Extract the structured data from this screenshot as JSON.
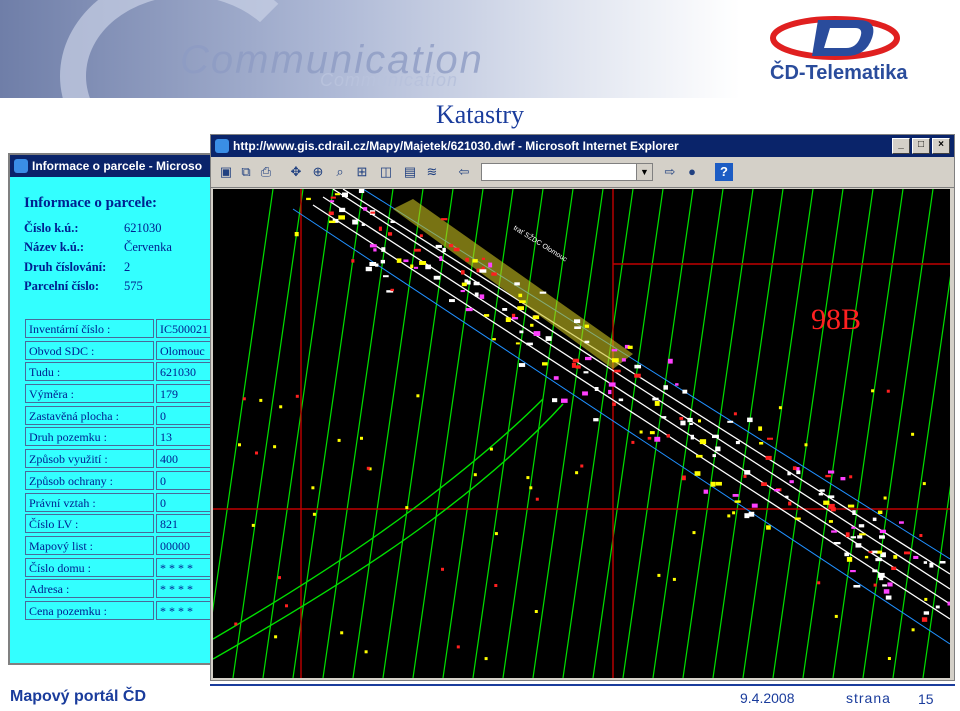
{
  "slide": {
    "title": "Katastry",
    "footer_left": "Mapový portál ČD",
    "footer_date": "9.4.2008",
    "footer_page_label": "strana",
    "footer_page_number": "15"
  },
  "banner": {
    "text_large": "Communication",
    "text_small": "Communication"
  },
  "logo": {
    "brand": "ČD-Telematika",
    "colors": {
      "red": "#e02020",
      "blue": "#2a4c9c"
    }
  },
  "info_window": {
    "title": "Informace o parcele - Microso",
    "heading": "Informace o parcele:",
    "fields": [
      {
        "label": "Číslo k.ú.:",
        "value": "621030"
      },
      {
        "label": "Název k.ú.:",
        "value": "Červenka"
      },
      {
        "label": "Druh číslování:",
        "value": "2"
      },
      {
        "label": "Parcelní číslo:",
        "value": "575"
      }
    ],
    "table": [
      {
        "label": "Inventární číslo :",
        "value": "IC500021"
      },
      {
        "label": "Obvod SDC :",
        "value": "Olomouc"
      },
      {
        "label": "Tudu :",
        "value": "621030"
      },
      {
        "label": "Výměra :",
        "value": "179"
      },
      {
        "label": "Zastavěná plocha :",
        "value": "0"
      },
      {
        "label": "Druh pozemku :",
        "value": "13"
      },
      {
        "label": "Způsob využití :",
        "value": "400"
      },
      {
        "label": "Způsob ochrany :",
        "value": "0"
      },
      {
        "label": "Právní vztah :",
        "value": "0"
      },
      {
        "label": "Číslo LV :",
        "value": "821"
      },
      {
        "label": "Mapový list :",
        "value": "00000"
      },
      {
        "label": "Číslo domu :",
        "value": "* * * *"
      },
      {
        "label": "Adresa :",
        "value": "* * * *"
      },
      {
        "label": "Cena pozemku :",
        "value": "* * * *"
      }
    ],
    "background_color": "#33ffff"
  },
  "browser": {
    "title": "http://www.gis.cdrail.cz/Mapy/Majetek/621030.dwf - Microsoft Internet Explorer",
    "window_buttons": [
      "_",
      "□",
      "×"
    ],
    "map": {
      "sheet_label": "98B",
      "rail_label": "trať SŽDC Olomouc",
      "colors": {
        "parcel_lines": "#00e000",
        "sheet_grid": "#c00000",
        "rails": "#ffffff",
        "label": "#ff2020"
      }
    }
  }
}
